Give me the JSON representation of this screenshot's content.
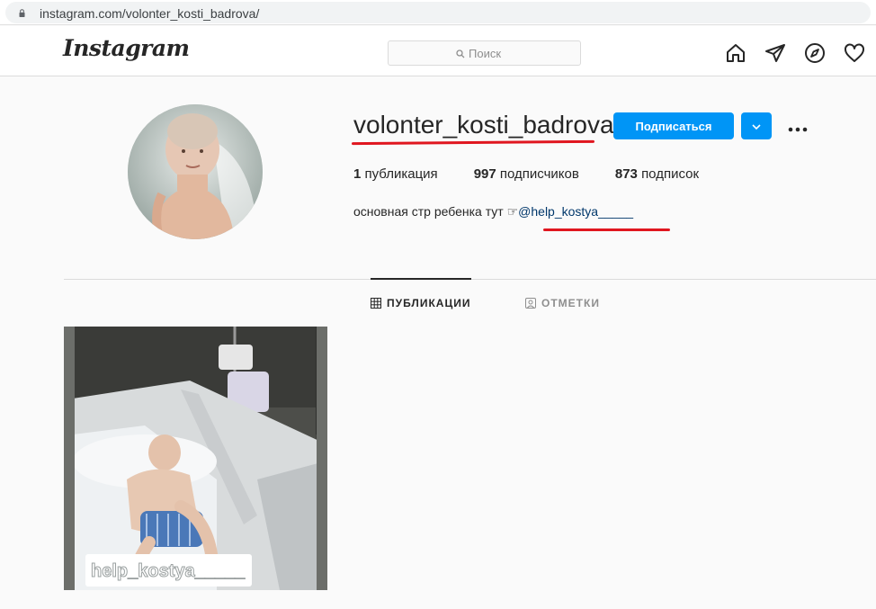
{
  "browser": {
    "url": "instagram.com/volonter_kosti_badrova/"
  },
  "header": {
    "logo": "Instagram",
    "search_placeholder": "Поиск",
    "nav_icons": [
      "home-icon",
      "direct-icon",
      "explore-icon",
      "activity-icon"
    ]
  },
  "profile": {
    "username": "volonter_kosti_badrova",
    "follow_label": "Подписаться",
    "stats": {
      "posts_count": "1",
      "posts_label": "публикация",
      "followers_count": "997",
      "followers_label": "подписчиков",
      "following_count": "873",
      "following_label": "подписок"
    },
    "bio_text": "основная стр ребенка тут ☞",
    "bio_link": "@help_kostya_____"
  },
  "tabs": [
    {
      "label": "ПУБЛИКАЦИИ",
      "active": true,
      "icon": "grid-icon"
    },
    {
      "label": "ОТМЕТКИ",
      "active": false,
      "icon": "tagged-icon"
    }
  ],
  "posts": [
    {
      "caption_overlay": "help_kostya_____"
    }
  ],
  "colors": {
    "accent": "#0095f6",
    "annotation_red": "#e0161f",
    "link": "#00376b"
  }
}
